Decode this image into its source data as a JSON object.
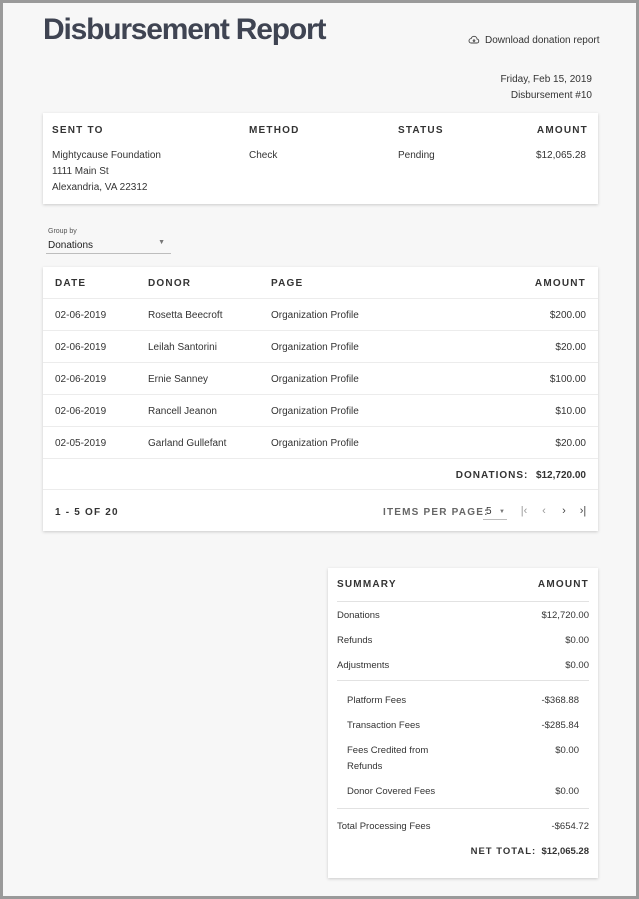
{
  "header": {
    "title": "Disbursement Report",
    "download_label": "Download donation report",
    "date": "Friday, Feb 15, 2019",
    "disbursement": "Disbursement #10"
  },
  "sent_card": {
    "headers": {
      "sent_to": "SENT TO",
      "method": "METHOD",
      "status": "STATUS",
      "amount": "AMOUNT"
    },
    "recipient": [
      "Mightycause Foundation",
      "1111 Main St",
      "Alexandria, VA 22312"
    ],
    "method": "Check",
    "status": "Pending",
    "amount": "$12,065.28"
  },
  "group_by": {
    "label": "Group by",
    "value": "Donations"
  },
  "donations": {
    "headers": {
      "date": "DATE",
      "donor": "DONOR",
      "page": "PAGE",
      "amount": "AMOUNT"
    },
    "rows": [
      {
        "date": "02-06-2019",
        "donor": "Rosetta Beecroft",
        "page": "Organization Profile",
        "amount": "$200.00"
      },
      {
        "date": "02-06-2019",
        "donor": "Leilah Santorini",
        "page": "Organization Profile",
        "amount": "$20.00"
      },
      {
        "date": "02-06-2019",
        "donor": "Ernie Sanney",
        "page": "Organization Profile",
        "amount": "$100.00"
      },
      {
        "date": "02-06-2019",
        "donor": "Rancell Jeanon",
        "page": "Organization Profile",
        "amount": "$10.00"
      },
      {
        "date": "02-05-2019",
        "donor": "Garland Gullefant",
        "page": "Organization Profile",
        "amount": "$20.00"
      }
    ],
    "total_label": "DONATIONS:",
    "total_value": "$12,720.00",
    "pager": {
      "range": "1 - 5 OF 20",
      "items_per_page_label": "ITEMS PER PAGE:",
      "items_per_page": "5",
      "first": "|‹",
      "prev": "‹",
      "next": "›",
      "last": "›|"
    }
  },
  "summary": {
    "header": "SUMMARY",
    "amount_header": "AMOUNT",
    "donations_label": "Donations",
    "donations": "$12,720.00",
    "refunds_label": "Refunds",
    "refunds": "$0.00",
    "adjustments_label": "Adjustments",
    "adjustments": "$0.00",
    "platform_label": "Platform Fees",
    "platform": "-$368.88",
    "transaction_label": "Transaction Fees",
    "transaction": "-$285.84",
    "credited_label_1": "Fees Credited from",
    "credited_label_2": "Refunds",
    "credited": "$0.00",
    "donor_covered_label": "Donor Covered Fees",
    "donor_covered": "$0.00",
    "total_processing_label": "Total Processing Fees",
    "total_processing": "-$654.72",
    "net_label": "NET TOTAL:",
    "net": "$12,065.28"
  }
}
